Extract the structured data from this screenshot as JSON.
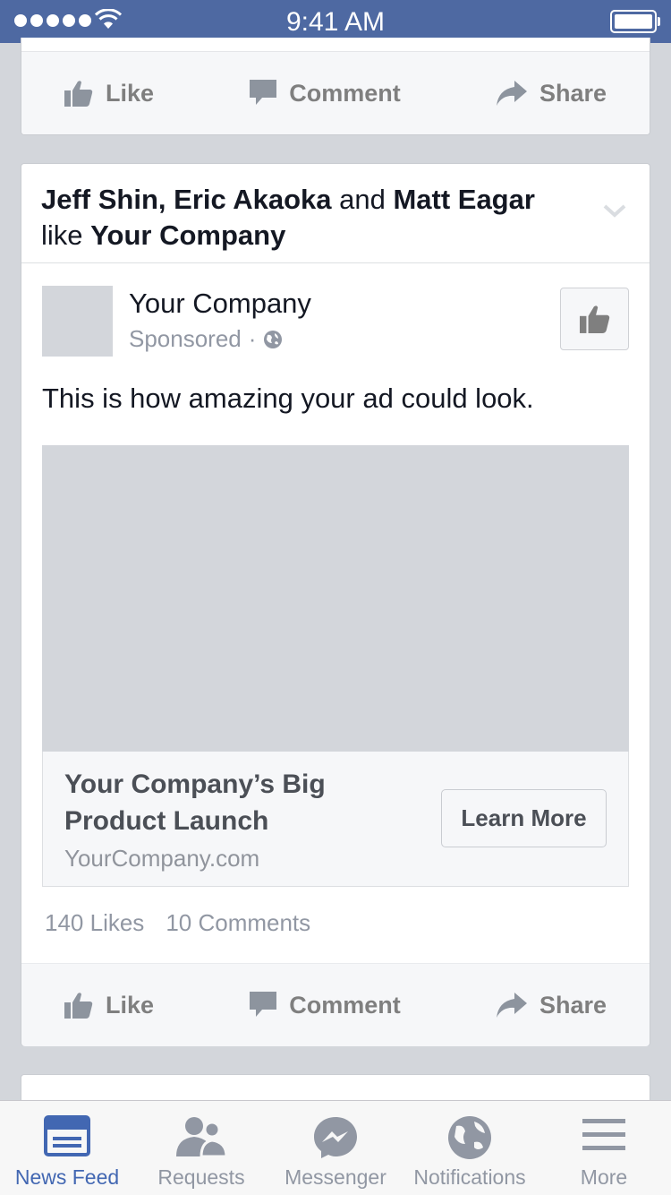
{
  "status_bar": {
    "time": "9:41 AM",
    "signal_icon": "signal-dots-icon",
    "wifi_icon": "wifi-icon",
    "battery_icon": "battery-icon"
  },
  "top_card": {
    "actions": {
      "like": "Like",
      "comment": "Comment",
      "share": "Share"
    }
  },
  "story": {
    "context": {
      "actor1": "Jeff Shin",
      "sep1": ", ",
      "actor2": "Eric Akaoka",
      "and": " and ",
      "actor3": "Matt Eagar",
      "verb": "like ",
      "page": "Your Company"
    },
    "page_name": "Your Company",
    "sponsored": "Sponsored",
    "sponsored_sep": "·",
    "message": "This is how amazing your ad could look.",
    "ad": {
      "headline": "Your Company’s Big Product Launch",
      "url": "YourCompany.com",
      "cta": "Learn More"
    },
    "counts": {
      "likes": "140 Likes",
      "comments": "10 Comments"
    },
    "actions": {
      "like": "Like",
      "comment": "Comment",
      "share": "Share"
    }
  },
  "tab_bar": {
    "tabs": [
      {
        "label": "News Feed",
        "icon": "news-feed-icon",
        "active": true
      },
      {
        "label": "Requests",
        "icon": "requests-icon",
        "active": false
      },
      {
        "label": "Messenger",
        "icon": "messenger-icon",
        "active": false
      },
      {
        "label": "Notifications",
        "icon": "notifications-globe-icon",
        "active": false
      },
      {
        "label": "More",
        "icon": "more-menu-icon",
        "active": false
      }
    ]
  },
  "colors": {
    "status_bar": "#4e69a2",
    "background": "#d3d6db",
    "active_tab": "#4267b2",
    "inactive_tab": "#9197a3",
    "action_gray": "#7f7f7f"
  }
}
